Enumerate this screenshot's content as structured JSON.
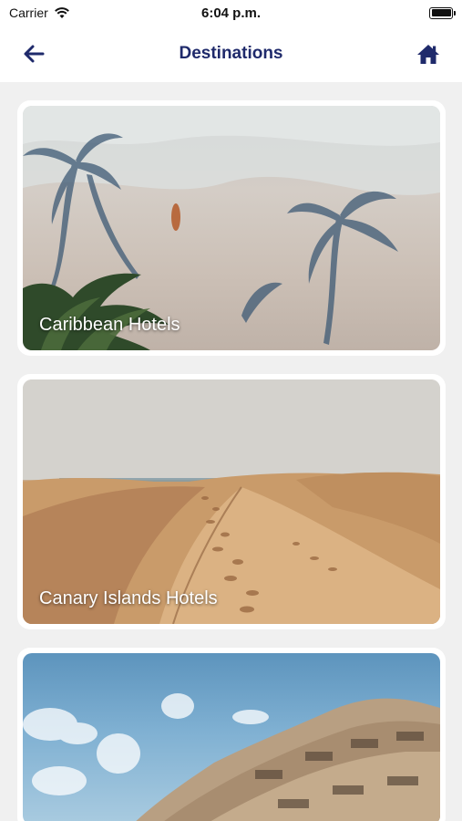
{
  "status_bar": {
    "carrier": "Carrier",
    "time": "6:04 p.m."
  },
  "nav": {
    "title": "Destinations",
    "back_icon": "arrow-left-icon",
    "home_icon": "home-icon",
    "color": "#1f2a6b"
  },
  "destinations": [
    {
      "label": "Caribbean Hotels",
      "image": "aerial-beach-palm-shadows"
    },
    {
      "label": "Canary Islands Hotels",
      "image": "sand-dunes-footprints"
    },
    {
      "label": "",
      "image": "curved-building-blue-sky"
    }
  ]
}
